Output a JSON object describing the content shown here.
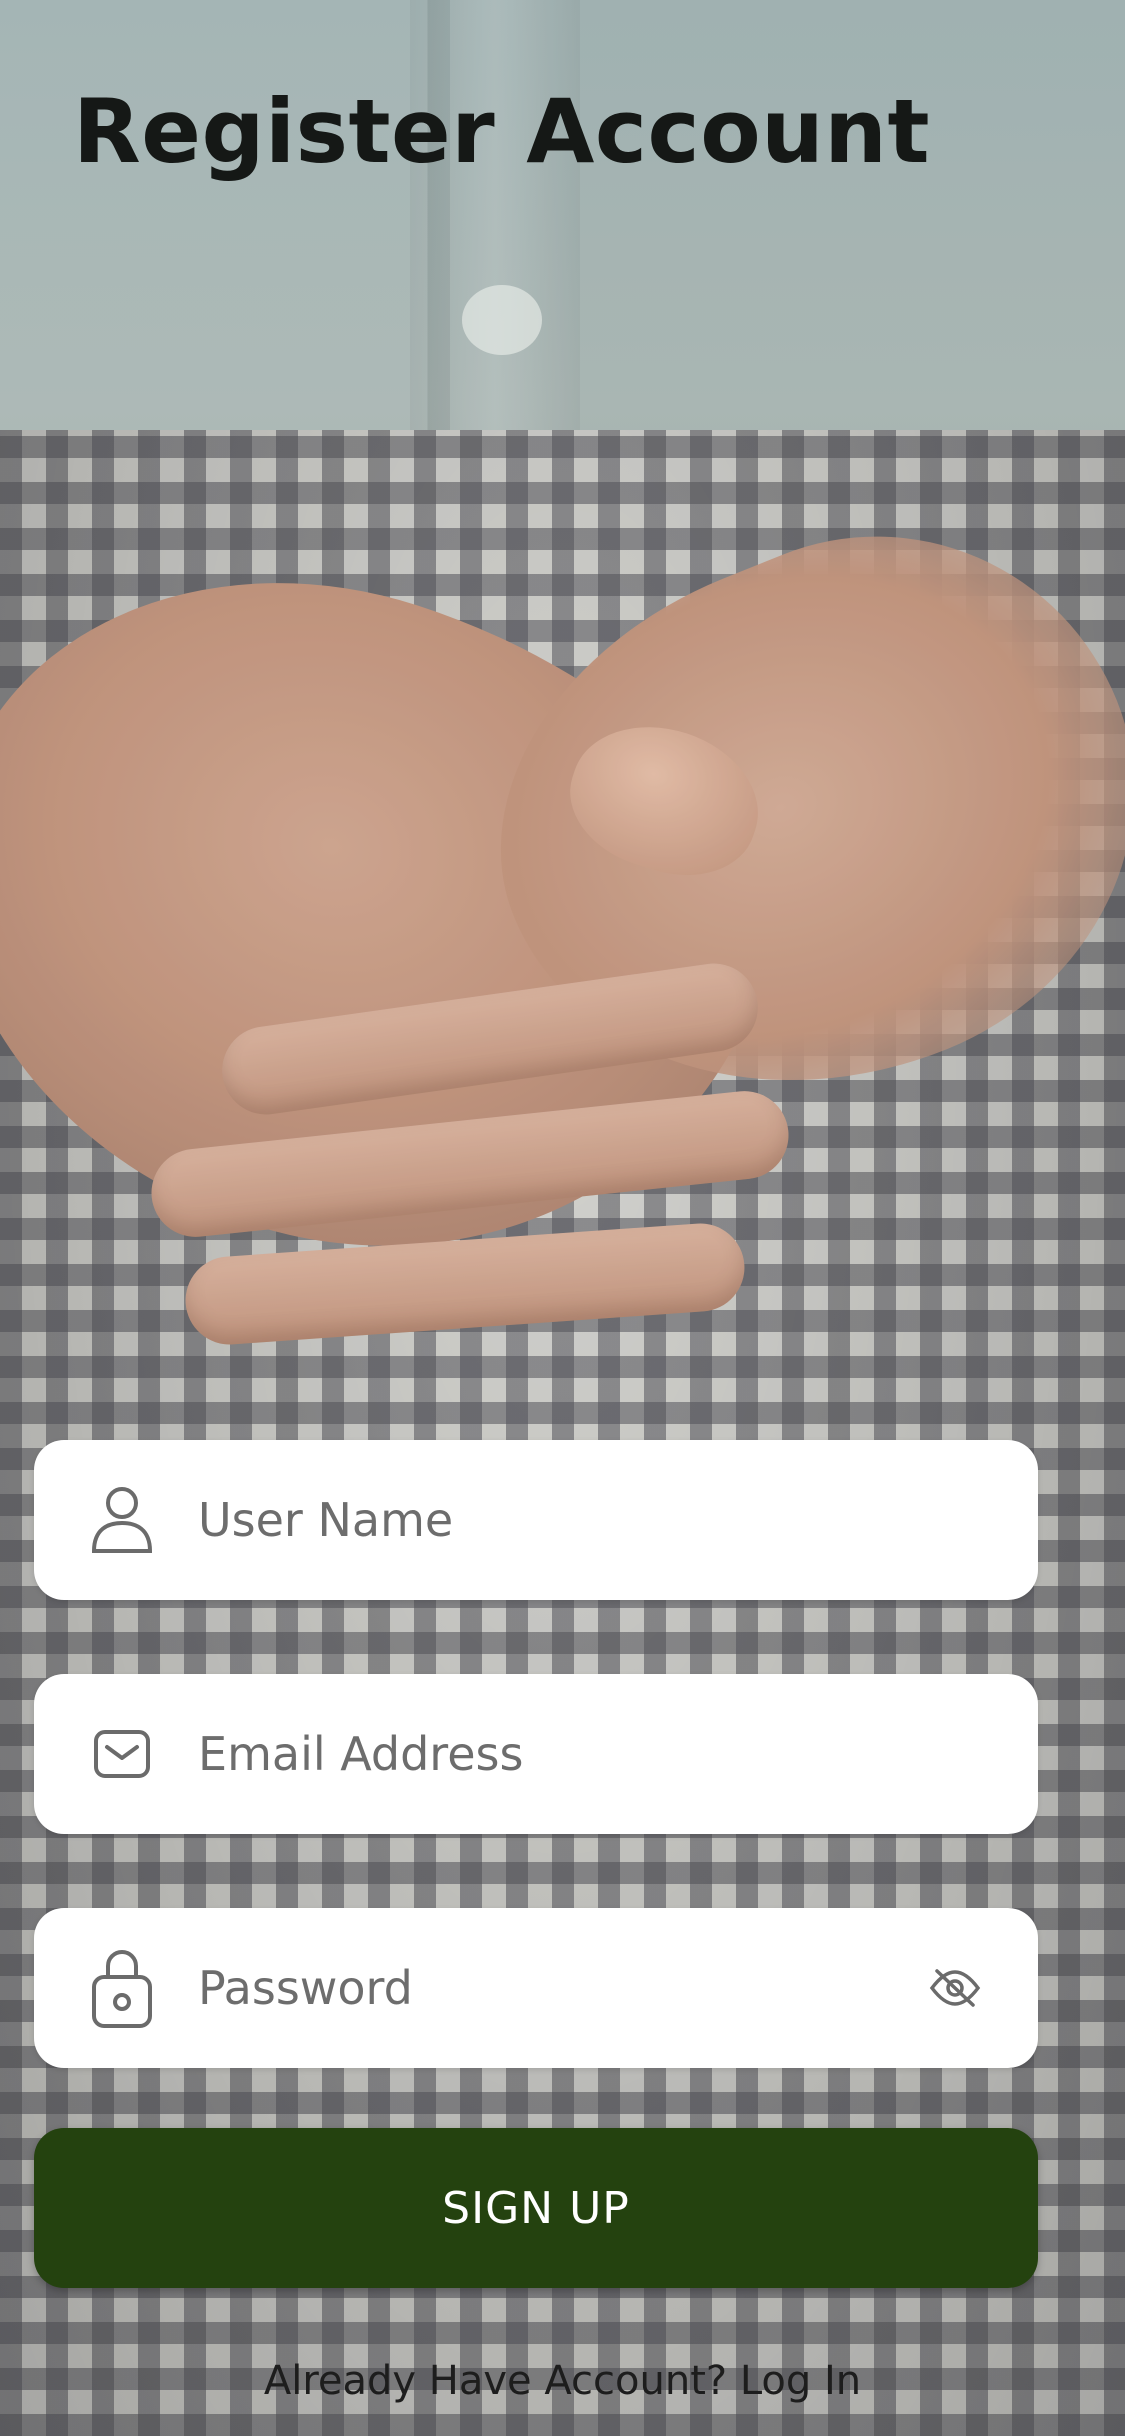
{
  "page": {
    "title": "Register Account"
  },
  "form": {
    "username": {
      "placeholder": "User Name",
      "value": "",
      "icon": "user-icon"
    },
    "email": {
      "placeholder": "Email Address",
      "value": "",
      "icon": "mail-icon"
    },
    "password": {
      "placeholder": "Password",
      "value": "",
      "icon": "lock-icon",
      "toggle_icon": "eye-off-icon"
    }
  },
  "actions": {
    "signup_label": "SIGN UP",
    "login_prompt": "Already Have Account?",
    "login_link": "Log In"
  },
  "colors": {
    "primary": "#24420f",
    "field_bg": "#ffffff",
    "title": "#151816",
    "icon": "#6b6b6b"
  }
}
